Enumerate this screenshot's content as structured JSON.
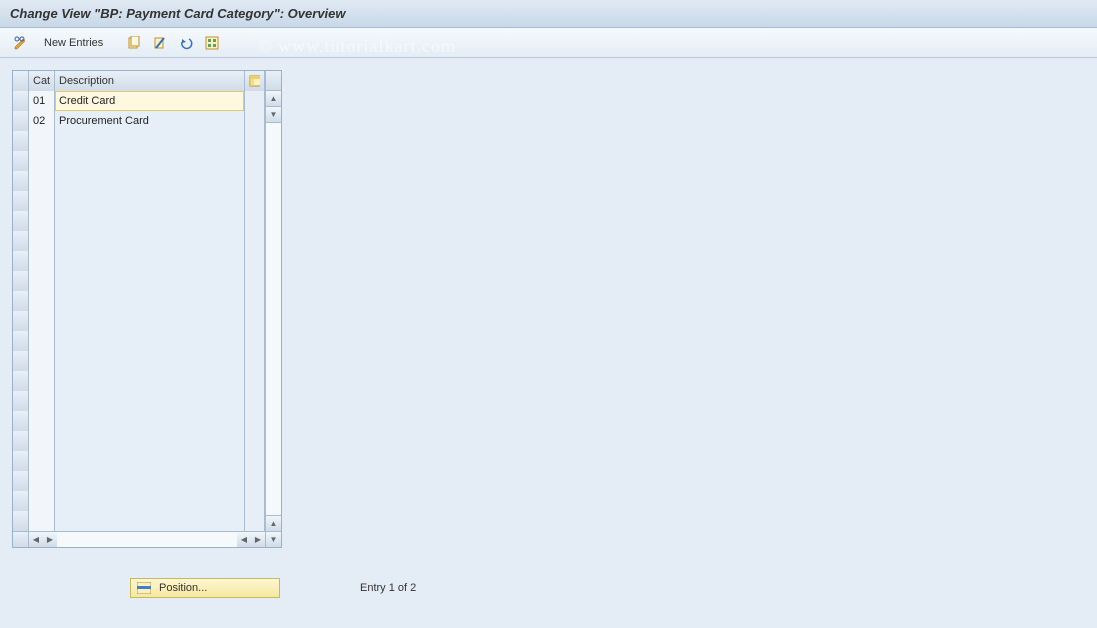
{
  "title": "Change View \"BP: Payment Card Category\": Overview",
  "toolbar": {
    "new_entries_label": "New Entries"
  },
  "table": {
    "headers": {
      "cat": "Cat",
      "desc": "Description"
    },
    "rows": [
      {
        "cat": "01",
        "desc": "Credit Card",
        "selected": true
      },
      {
        "cat": "02",
        "desc": "Procurement Card",
        "selected": false
      }
    ],
    "empty_rows": 20
  },
  "footer": {
    "position_label": "Position...",
    "entry_text": "Entry 1 of 2"
  },
  "watermark": "© www.tutorialkart.com"
}
